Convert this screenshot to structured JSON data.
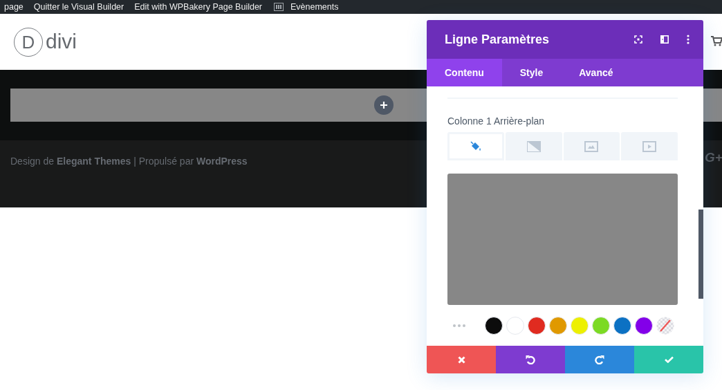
{
  "admin_bar": {
    "items": [
      {
        "label": "page",
        "kind": "plain"
      },
      {
        "label": "Quitter le Visual Builder",
        "kind": "plain"
      },
      {
        "label": "Edit with WPBakery Page Builder",
        "kind": "plain"
      },
      {
        "label": "Evènements",
        "kind": "icon"
      }
    ]
  },
  "header": {
    "logo_letter": "D",
    "logo_text": "divi"
  },
  "footer": {
    "credits": "Design de **Elegant Themes** | Propulsé par **WordPress**",
    "social_icon": "G+"
  },
  "panel": {
    "title": "Ligne Paramètres",
    "tabs": [
      {
        "label": "Contenu",
        "selected": true
      },
      {
        "label": "Style",
        "selected": false
      },
      {
        "label": "Avancé",
        "selected": false
      }
    ],
    "field_label": "Colonne 1 Arrière-plan",
    "background_types": [
      {
        "kind": "color",
        "selected": true
      },
      {
        "kind": "gradient",
        "selected": false
      },
      {
        "kind": "image",
        "selected": false
      },
      {
        "kind": "video",
        "selected": false
      }
    ],
    "swatches": [
      {
        "kind": "color",
        "color": "#0c0c0c"
      },
      {
        "kind": "color",
        "color": "#ffffff"
      },
      {
        "kind": "color",
        "color": "#e02b20"
      },
      {
        "kind": "color",
        "color": "#e09900"
      },
      {
        "kind": "color",
        "color": "#edf000"
      },
      {
        "kind": "color",
        "color": "#7cda24"
      },
      {
        "kind": "color",
        "color": "#0c71c3"
      },
      {
        "kind": "color",
        "color": "#8300e9"
      },
      {
        "kind": "clear"
      }
    ]
  }
}
